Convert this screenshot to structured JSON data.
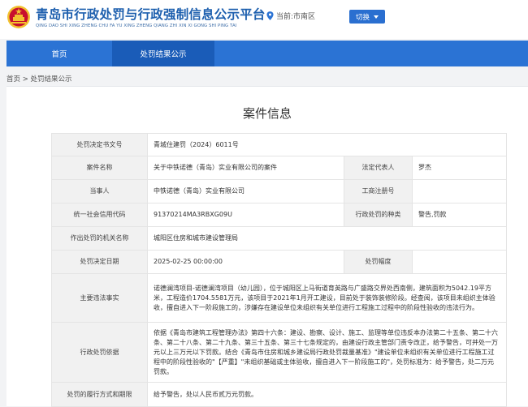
{
  "header": {
    "title": "青岛市行政处罚与行政强制信息公示平台",
    "pinyin": "QING DAO SHI XING ZHENG CHU FA YU XING ZHENG QIANG ZHI XIN XI GONG SHI PING TAI",
    "location_label": "当前:市南区",
    "switch_label": "切换"
  },
  "nav": {
    "items": [
      {
        "label": "首页"
      },
      {
        "label": "处罚结果公示"
      }
    ]
  },
  "breadcrumb": "首页 > 处罚结果公示",
  "case": {
    "heading": "案件信息",
    "rows": {
      "decision_no_label": "处罚决定书文号",
      "decision_no": "青城住建罚（2024）6011号",
      "case_name_label": "案件名称",
      "case_name": "关于中铁诺德（青岛）实业有限公司的案件",
      "legal_rep_label": "法定代表人",
      "legal_rep": "罗杰",
      "party_label": "当事人",
      "party": "中铁诺德（青岛）实业有限公司",
      "biz_reg_label": "工商注册号",
      "biz_reg": "",
      "credit_code_label": "统一社会信用代码",
      "credit_code": "91370214MA3RBXG09U",
      "penalty_type_label": "行政处罚的种类",
      "penalty_type": "警告,罚款",
      "authority_label": "作出处罚的机关名称",
      "authority": "城阳区住房和城市建设管理局",
      "date_label": "处罚决定日期",
      "date": "2025-02-25 00:00:00",
      "amount_label": "处罚幅度",
      "amount": "",
      "facts_label": "主要违法事实",
      "facts": "诺德澜湾项目-诺德澜湾项目（幼儿园），位于城阳区上马街道育英路与广盛路交界处西南侧，建筑面积为5042.19平方米，工程造价1704.5581万元，该项目于2021年1月开工建设，目前处于装饰装修阶段。经查阅，该项目未组织主体验收，擅自进入下一阶段施工的，涉嫌存在建设单位未组织有关单位进行工程施工过程中的阶段性验收的违法行为。",
      "basis_label": "行政处罚依据",
      "basis": "依据《青岛市建筑工程管理办法》第四十六条：建设、勘察、设计、施工、监理等单位违反本办法第二十五条、第二十六条、第二十八条、第二十九条、第三十五条、第三十七条规定的，由建设行政主管部门责令改正，给予警告，可并处一万元以上三万元以下罚款。结合《青岛市住房和城乡建设局行政处罚裁量基准》\"建设单位未组织有关单位进行工程施工过程中的阶段性验收的\"【严重】\"未组织基础或主体验收，擅自进入下一阶段施工的\"，处罚标准为：给予警告，处二万元罚款。",
      "method_label": "处罚的履行方式和期限",
      "method": "给予警告，处以人民币贰万元罚款。"
    }
  },
  "colors": {
    "brand_blue": "#1d5fae",
    "nav_blue": "#2b73d4",
    "nav_active": "#1a5cb8",
    "emblem_red": "#c8102e",
    "emblem_gold": "#f2c230"
  },
  "icons": [
    "national-emblem-icon",
    "location-pin-icon",
    "caret-down-icon"
  ]
}
